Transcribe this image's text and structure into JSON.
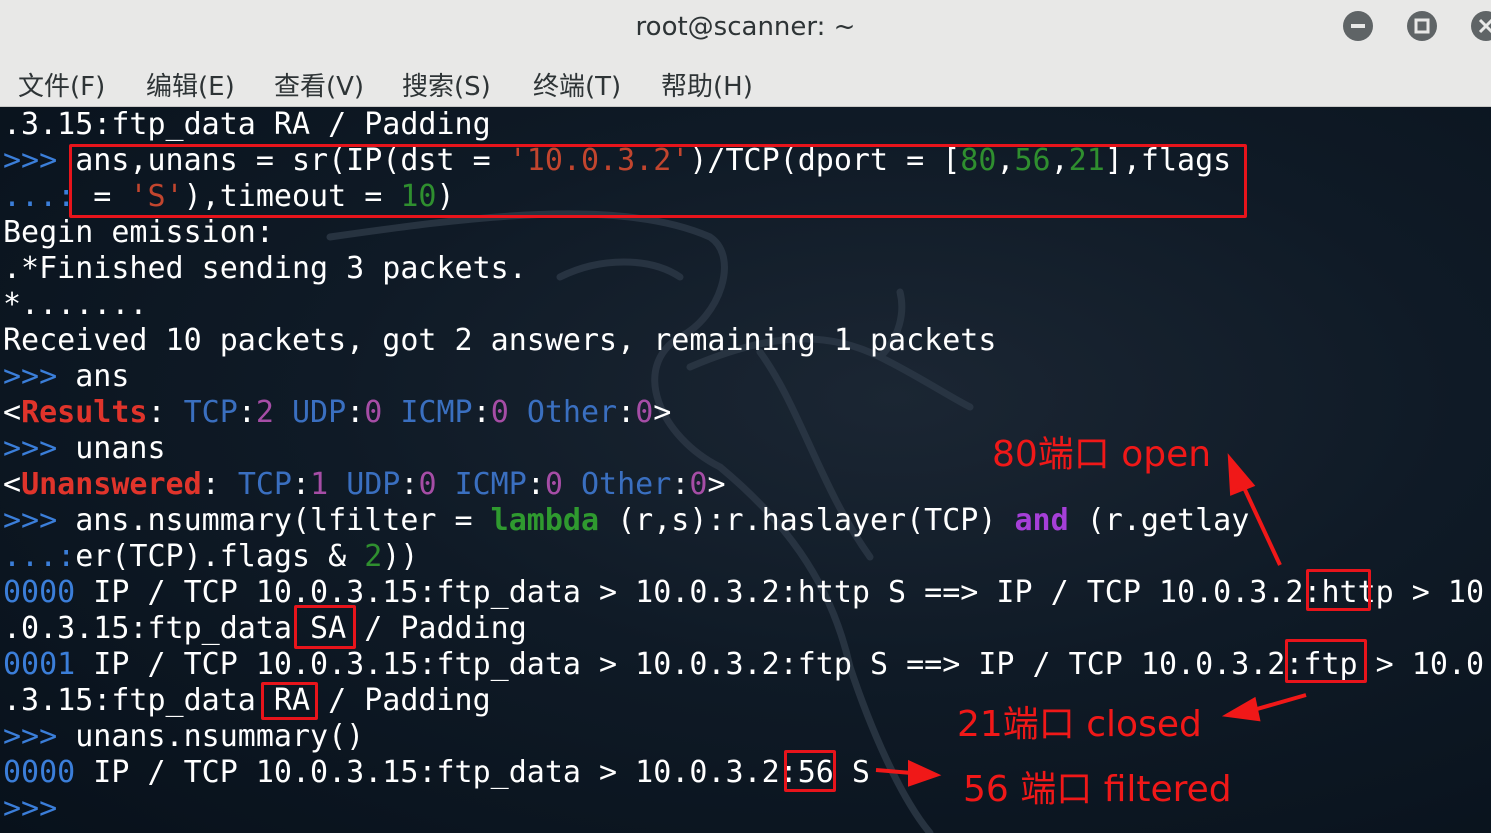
{
  "window": {
    "title": "root@scanner: ~",
    "buttons": [
      "minimize-icon",
      "maximize-icon",
      "close-icon"
    ]
  },
  "menu": [
    "文件(F)",
    "编辑(E)",
    "查看(V)",
    "搜索(S)",
    "终端(T)",
    "帮助(H)"
  ],
  "terminal": {
    "lines": [
      ".3.15:ftp_data RA / Padding",
      ">>> ans,unans = sr(IP(dst = '10.0.3.2')/TCP(dport = [80,56,21],flags",
      "...: = 'S'),timeout = 10)",
      "Begin emission:",
      ".*Finished sending 3 packets.",
      "*.......",
      "Received 10 packets, got 2 answers, remaining 1 packets",
      ">>> ans",
      "<Results: TCP:2 UDP:0 ICMP:0 Other:0>",
      ">>> unans",
      "<Unanswered: TCP:1 UDP:0 ICMP:0 Other:0>",
      ">>> ans.nsummary(lfilter = lambda (r,s):r.haslayer(TCP) and (r.getlay",
      "...:er(TCP).flags & 2))",
      "0000 IP / TCP 10.0.3.15:ftp_data > 10.0.3.2:http S ==> IP / TCP 10.0.3.2:http > 10",
      ".0.3.15:ftp_data SA / Padding",
      "0001 IP / TCP 10.0.3.15:ftp_data > 10.0.3.2:ftp S ==> IP / TCP 10.0.3.2:ftp > 10.0",
      ".3.15:ftp_data RA / Padding",
      ">>> unans.nsummary()",
      "0000 IP / TCP 10.0.3.15:ftp_data > 10.0.3.2:56 S",
      ">>>"
    ]
  },
  "annotations": {
    "port80": "80端口 open",
    "port21": "21端口 closed",
    "port56": "56 端口 filtered"
  },
  "colors": {
    "annotation": "#f01818",
    "prompt": "#3b7ed9",
    "string": "#c2452e",
    "number": "#2f8f2f"
  }
}
